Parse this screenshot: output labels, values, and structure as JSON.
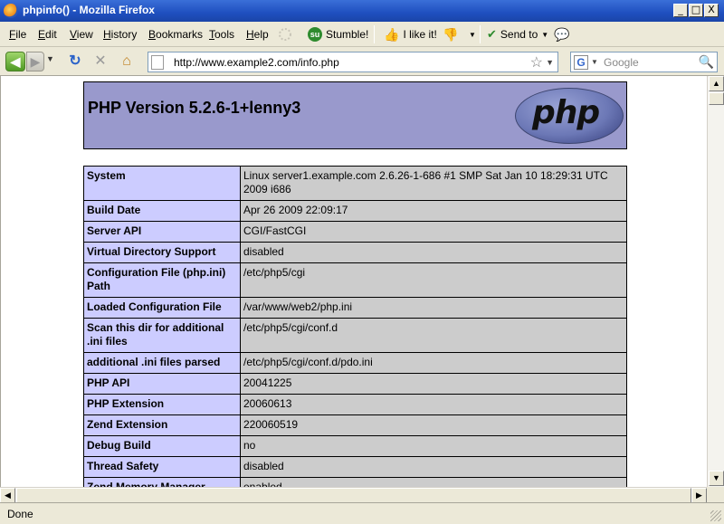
{
  "window": {
    "title": "phpinfo() - Mozilla Firefox",
    "controls": {
      "minimize": "_",
      "maximize": "□",
      "close": "X"
    }
  },
  "menu": {
    "items": [
      {
        "label": "File",
        "key": "F",
        "rest": "ile"
      },
      {
        "label": "Edit",
        "key": "E",
        "rest": "dit"
      },
      {
        "label": "View",
        "key": "V",
        "rest": "iew"
      },
      {
        "label": "History",
        "key": "H",
        "rest": "istory"
      },
      {
        "label": "Bookmarks",
        "key": "B",
        "rest": "ookmarks"
      },
      {
        "label": "Tools",
        "key": "T",
        "rest": "ools"
      },
      {
        "label": "Help",
        "key": "H",
        "rest": "elp"
      }
    ],
    "toolbar": {
      "stumble_label": "Stumble!",
      "ilike_label": "I like it!",
      "sendto_label": "Send to"
    }
  },
  "nav": {
    "url": "http://www.example2.com/info.php",
    "search_placeholder": "Google",
    "search_engine_letter": "G"
  },
  "page": {
    "php_version_title": "PHP Version 5.2.6-1+lenny3",
    "logo_text": "php",
    "rows": [
      {
        "name": "System",
        "value": "Linux server1.example.com 2.6.26-1-686 #1 SMP Sat Jan 10 18:29:31 UTC 2009 i686"
      },
      {
        "name": "Build Date",
        "value": "Apr 26 2009 22:09:17"
      },
      {
        "name": "Server API",
        "value": "CGI/FastCGI"
      },
      {
        "name": "Virtual Directory Support",
        "value": "disabled"
      },
      {
        "name": "Configuration File (php.ini) Path",
        "value": "/etc/php5/cgi"
      },
      {
        "name": "Loaded Configuration File",
        "value": "/var/www/web2/php.ini"
      },
      {
        "name": "Scan this dir for additional .ini files",
        "value": "/etc/php5/cgi/conf.d"
      },
      {
        "name": "additional .ini files parsed",
        "value": "/etc/php5/cgi/conf.d/pdo.ini"
      },
      {
        "name": "PHP API",
        "value": "20041225"
      },
      {
        "name": "PHP Extension",
        "value": "20060613"
      },
      {
        "name": "Zend Extension",
        "value": "220060519"
      },
      {
        "name": "Debug Build",
        "value": "no"
      },
      {
        "name": "Thread Safety",
        "value": "disabled"
      },
      {
        "name": "Zend Memory Manager",
        "value": "enabled"
      }
    ]
  },
  "status": {
    "text": "Done"
  },
  "colors": {
    "header_bg": "#9999cc",
    "key_bg": "#ccccff",
    "value_bg": "#cccccc"
  },
  "icons": [
    "firefox-icon",
    "back-arrow-icon",
    "forward-arrow-icon",
    "reload-icon",
    "stop-icon",
    "home-icon",
    "page-icon",
    "bookmark-star-icon",
    "google-icon",
    "search-magnifier-icon",
    "stumble-icon",
    "thumbs-up-icon",
    "thumbs-down-icon",
    "send-to-icon",
    "comment-icon",
    "throbber-icon"
  ]
}
